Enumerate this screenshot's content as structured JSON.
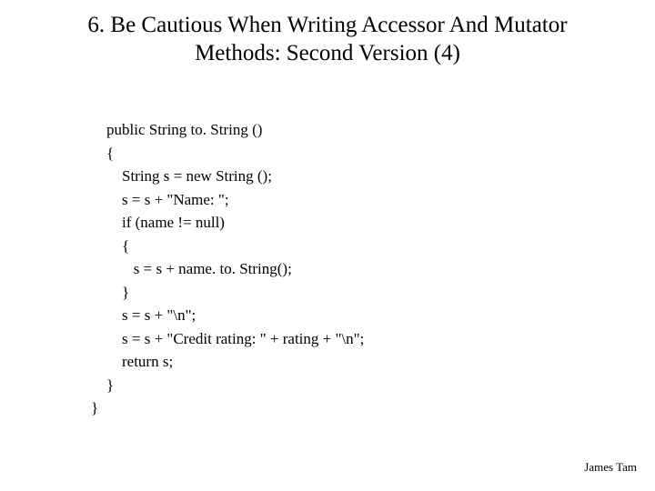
{
  "title_line1": "6. Be Cautious When Writing Accessor And Mutator",
  "title_line2": "Methods: Second Version (4)",
  "code": "    public String to. String ()\n    {\n        String s = new String ();\n        s = s + \"Name: \";\n        if (name != null)\n        {\n           s = s + name. to. String();\n        }\n        s = s + \"\\n\";\n        s = s + \"Credit rating: \" + rating + \"\\n\";\n        return s;\n    }\n}",
  "footer": "James Tam"
}
